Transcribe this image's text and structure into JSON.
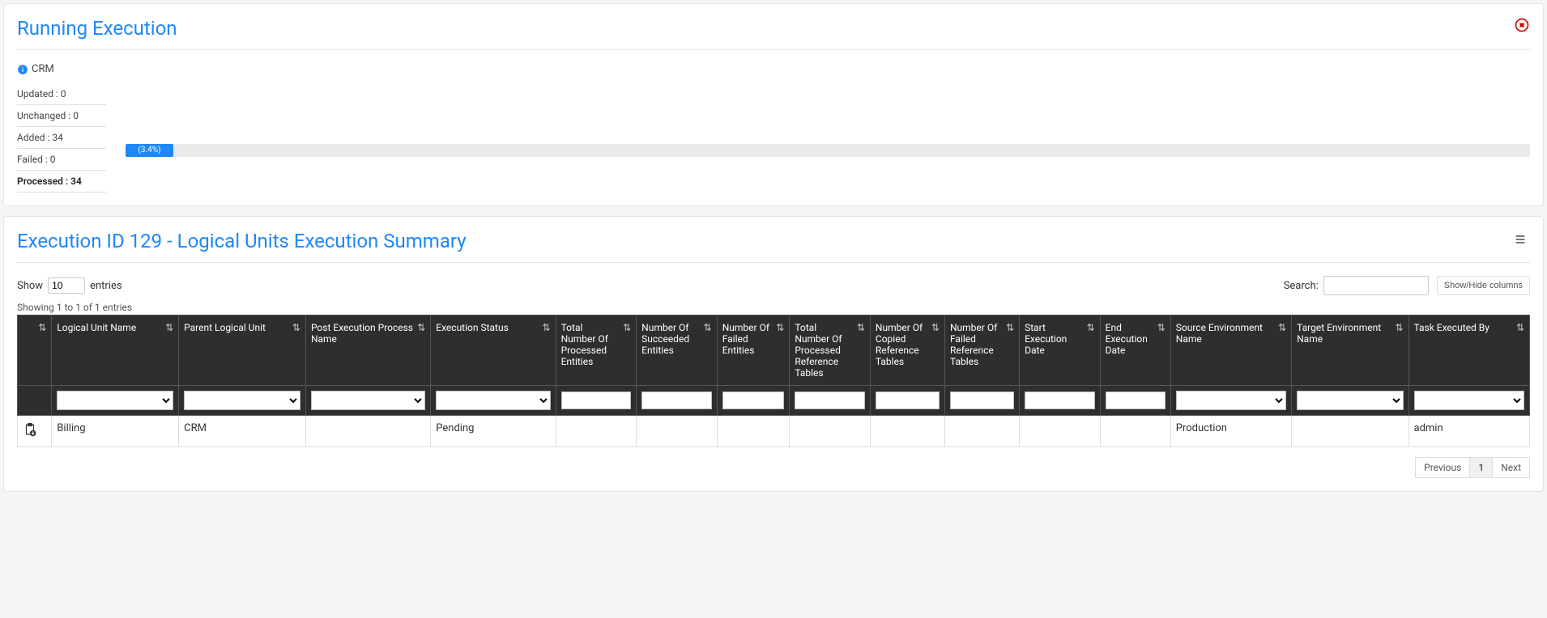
{
  "running": {
    "title": "Running Execution",
    "infoLabel": "CRM",
    "stats": {
      "updatedLabel": "Updated :",
      "updated": "0",
      "unchangedLabel": "Unchanged :",
      "unchanged": "0",
      "addedLabel": "Added :",
      "added": "34",
      "failedLabel": "Failed :",
      "failed": "0",
      "processedLabel": "Processed :",
      "processed": "34"
    },
    "progress": {
      "percentLabel": "(3.4%)",
      "percent": 3.4
    }
  },
  "summary": {
    "title": "Execution ID 129 - Logical Units Execution Summary",
    "showLabel": "Show",
    "entriesLabel": "entries",
    "showValue": "10",
    "searchLabel": "Search:",
    "toggleColsLabel": "Show/Hide columns",
    "tableInfo": "Showing 1 to 1 of 1 entries",
    "columns": {
      "logicalUnitName": "Logical Unit Name",
      "parentLogicalUnit": "Parent Logical Unit",
      "postExecutionProcessName": "Post Execution Process Name",
      "executionStatus": "Execution Status",
      "totalProcessedEntities": "Total Number Of Processed Entities",
      "succeededEntities": "Number Of Succeeded Entities",
      "failedEntities": "Number Of Failed Entities",
      "totalProcessedRefTables": "Total Number Of Processed Reference Tables",
      "copiedRefTables": "Number Of Copied Reference Tables",
      "failedRefTables": "Number Of Failed Reference Tables",
      "startExecDate": "Start Execution Date",
      "endExecDate": "End Execution Date",
      "sourceEnvName": "Source Environment Name",
      "targetEnvName": "Target Environment Name",
      "taskExecutedBy": "Task Executed By"
    },
    "rows": [
      {
        "logicalUnitName": "Billing",
        "parentLogicalUnit": "CRM",
        "postExecutionProcessName": "",
        "executionStatus": "Pending",
        "totalProcessedEntities": "",
        "succeededEntities": "",
        "failedEntities": "",
        "totalProcessedRefTables": "",
        "copiedRefTables": "",
        "failedRefTables": "",
        "startExecDate": "",
        "endExecDate": "",
        "sourceEnvName": "Production",
        "targetEnvName": "",
        "taskExecutedBy": "admin"
      }
    ],
    "pagination": {
      "prev": "Previous",
      "page": "1",
      "next": "Next"
    }
  }
}
